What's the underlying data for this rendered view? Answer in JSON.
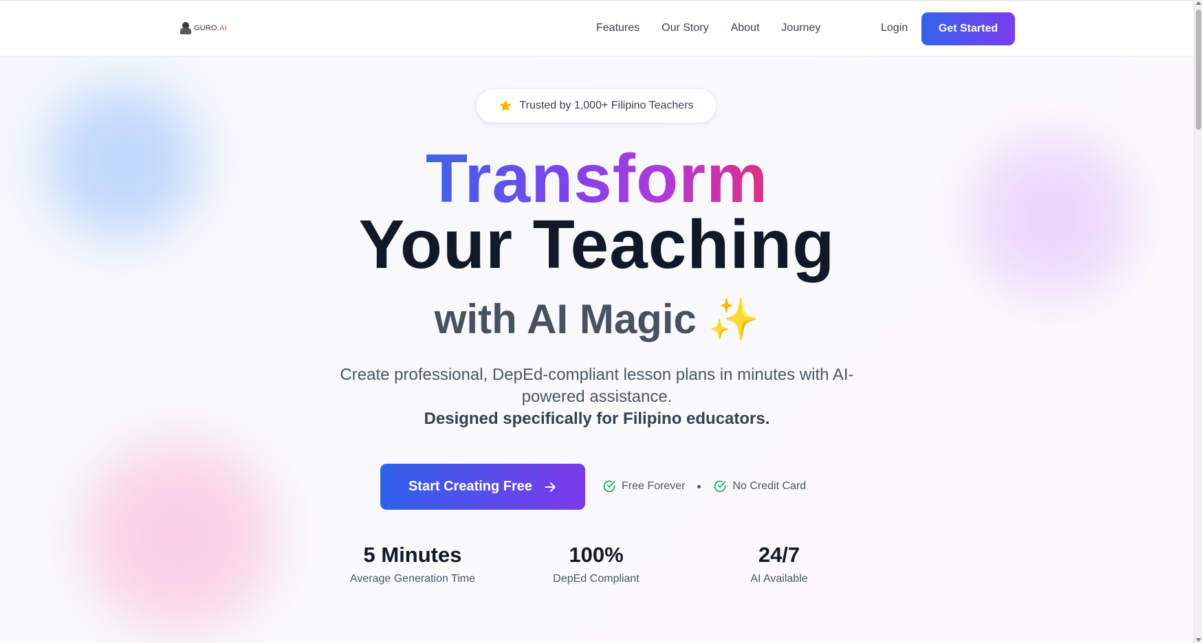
{
  "brand": {
    "logo_text": "GURO.",
    "logo_accent": "AI",
    "accent_start": "#3463ea",
    "accent_end": "#7b3cec"
  },
  "nav": {
    "links": [
      "Features",
      "Our Story",
      "About",
      "Journey"
    ],
    "login_label": "Login",
    "cta_label": "Get Started"
  },
  "hero": {
    "badge": {
      "icon": "star-icon",
      "text": "Trusted by 1,000+ Filipino Teachers"
    },
    "headline_gradient": "Transform",
    "headline_main": "Your Teaching",
    "headline_sub": "with AI Magic ✨",
    "description": "Create professional, DepEd-compliant lesson plans in minutes with AI-powered assistance.",
    "description_bold": "Designed specifically for Filipino educators.",
    "cta_label": "Start Creating Free",
    "cta_icon": "arrow-right-icon",
    "perks": [
      {
        "icon": "check-circle-icon",
        "label": "Free Forever"
      },
      {
        "icon": "check-circle-icon",
        "label": "No Credit Card"
      }
    ]
  },
  "stats": [
    {
      "value": "5 Minutes",
      "label": "Average Generation Time"
    },
    {
      "value": "100%",
      "label": "DepEd Compliant"
    },
    {
      "value": "24/7",
      "label": "AI Available"
    }
  ]
}
